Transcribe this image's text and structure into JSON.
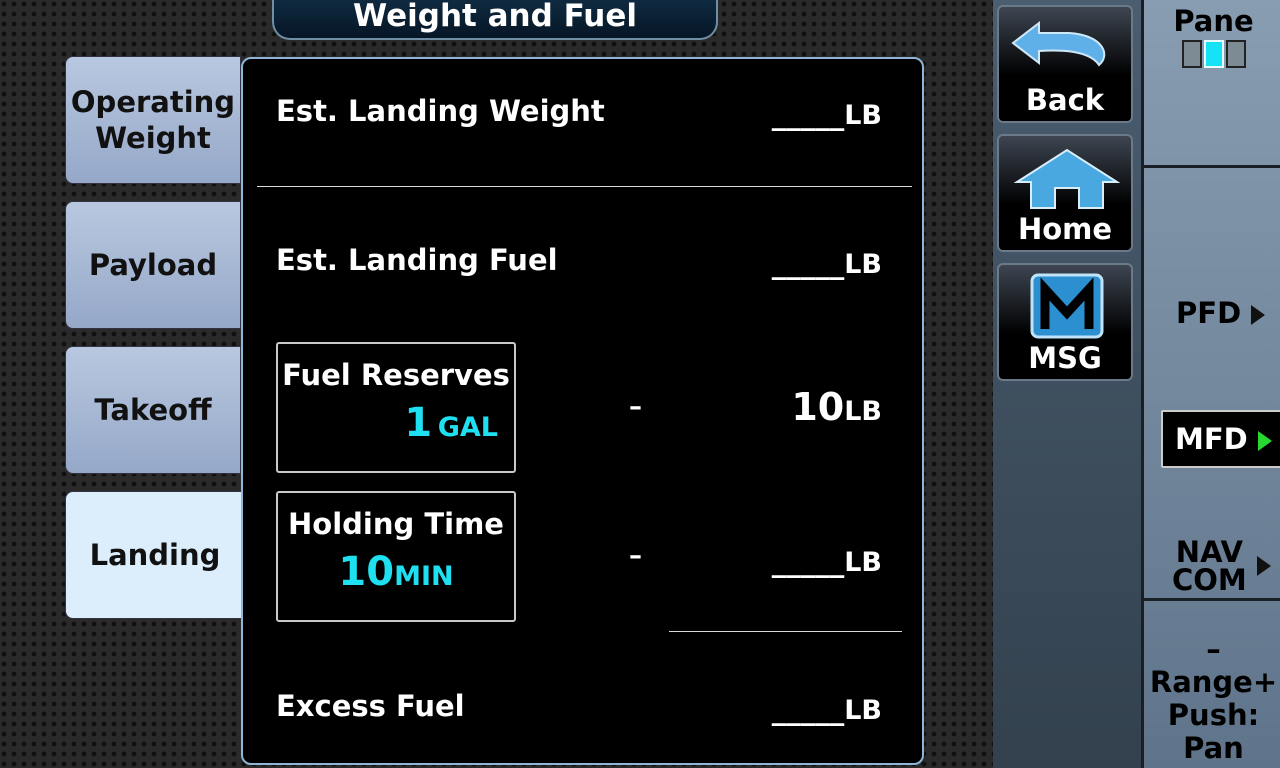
{
  "title": "Weight and Fuel",
  "tabs": [
    {
      "label": "Operating Weight",
      "active": false
    },
    {
      "label": "Payload",
      "active": false
    },
    {
      "label": "Takeoff",
      "active": false
    },
    {
      "label": "Landing",
      "active": true
    }
  ],
  "main": {
    "est_landing_weight": {
      "label": "Est. Landing Weight",
      "value": "_____",
      "unit": "LB"
    },
    "est_landing_fuel": {
      "label": "Est. Landing Fuel",
      "value": "_____",
      "unit": "LB"
    },
    "fuel_reserves": {
      "label": "Fuel Reserves",
      "value": "1",
      "unit": "GAL",
      "operator": "–",
      "result_value": "10",
      "result_unit": "LB"
    },
    "holding_time": {
      "label": "Holding Time",
      "value": "10",
      "unit": "MIN",
      "operator": "–",
      "result_value": "_____",
      "result_unit": "LB"
    },
    "excess_fuel": {
      "label": "Excess Fuel",
      "value": "_____",
      "unit": "LB"
    }
  },
  "buttons": {
    "back": {
      "label": "Back",
      "icon": "back-arrow-icon"
    },
    "home": {
      "label": "Home",
      "icon": "house-icon"
    },
    "msg": {
      "label": "MSG",
      "icon": "m-logo-icon"
    }
  },
  "strip": {
    "pane_label": "Pane",
    "pfd": "PFD",
    "mfd": "MFD",
    "nav": "NAV",
    "com": "COM",
    "range": "–Range+",
    "push": "Push:",
    "pan": "Pan"
  },
  "colors": {
    "cyan_value": "#1ee0f0",
    "active_tab": "#dceefc",
    "tab": "#a9bad6",
    "mfd_arrow": "#29d82f"
  }
}
